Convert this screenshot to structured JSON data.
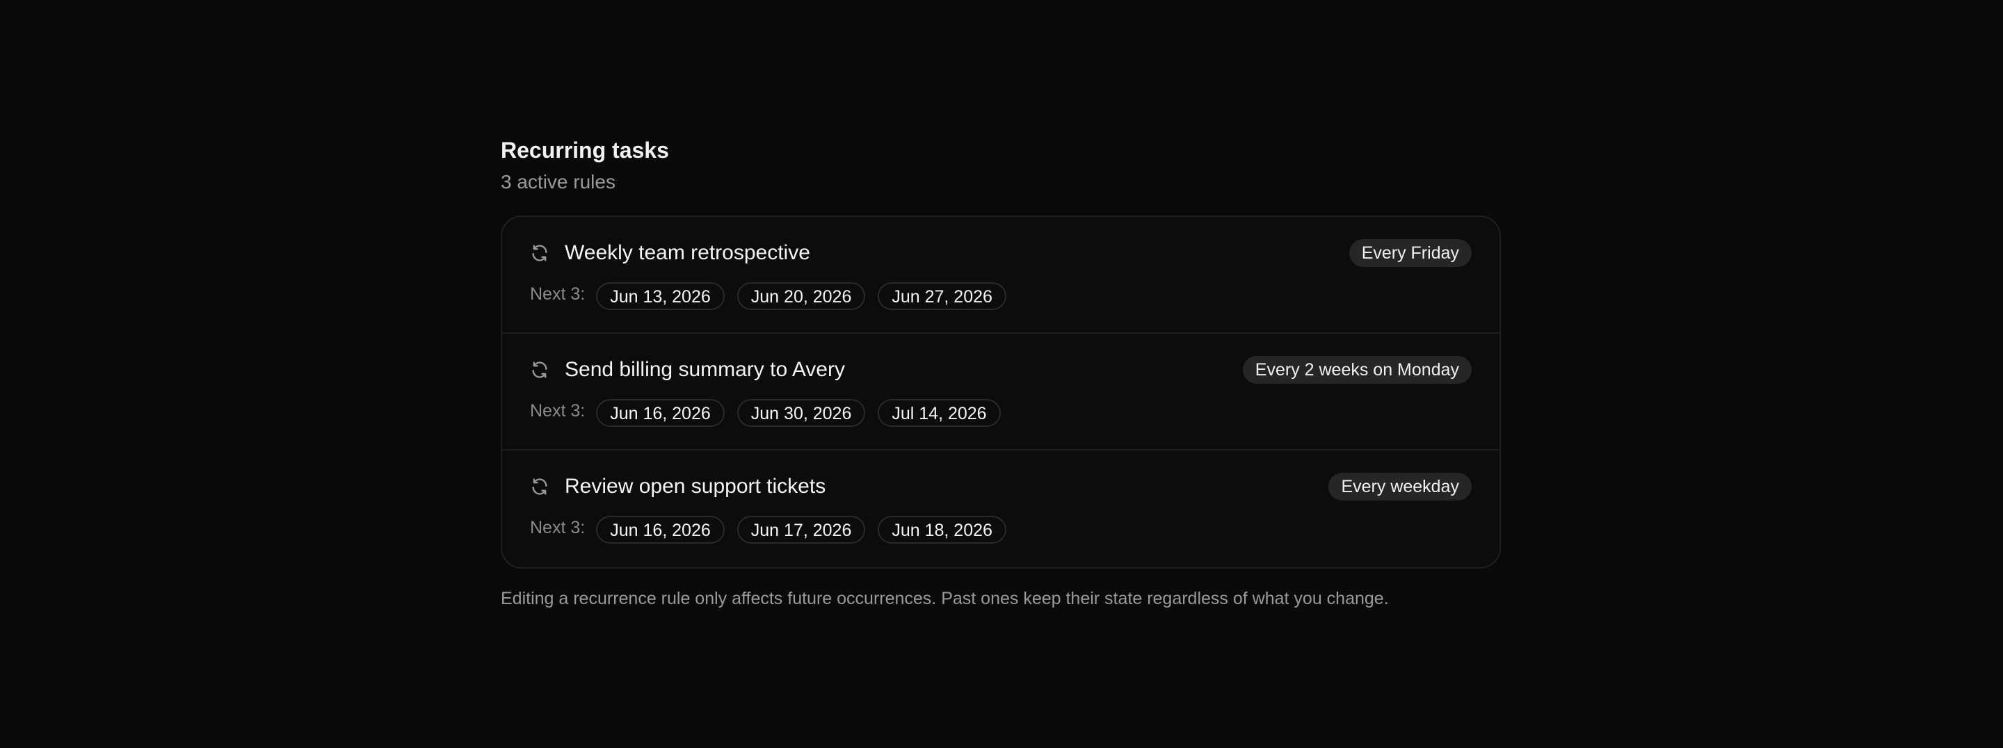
{
  "header": {
    "title": "Recurring tasks",
    "subtitle": "3 active rules"
  },
  "rules": [
    {
      "name": "Weekly team retrospective",
      "schedule": "Every Friday",
      "next_label": "Next 3:",
      "dates": [
        "Jun 13, 2026",
        "Jun 20, 2026",
        "Jun 27, 2026"
      ],
      "icon": "recurrence-icon"
    },
    {
      "name": "Send billing summary to Avery",
      "schedule": "Every 2 weeks on Monday",
      "next_label": "Next 3:",
      "dates": [
        "Jun 16, 2026",
        "Jun 30, 2026",
        "Jul 14, 2026"
      ],
      "icon": "recurrence-icon"
    },
    {
      "name": "Review open support tickets",
      "schedule": "Every weekday",
      "next_label": "Next 3:",
      "dates": [
        "Jun 16, 2026",
        "Jun 17, 2026",
        "Jun 18, 2026"
      ],
      "icon": "recurrence-icon"
    }
  ],
  "footnote": "Editing a recurrence rule only affects future occurrences. Past ones keep their state regardless of what you change.",
  "colors": {
    "background": "#0a0a0a",
    "card_border": "#1f1f1f",
    "badge_bg": "#262626",
    "muted_text": "#9a9a9a"
  }
}
